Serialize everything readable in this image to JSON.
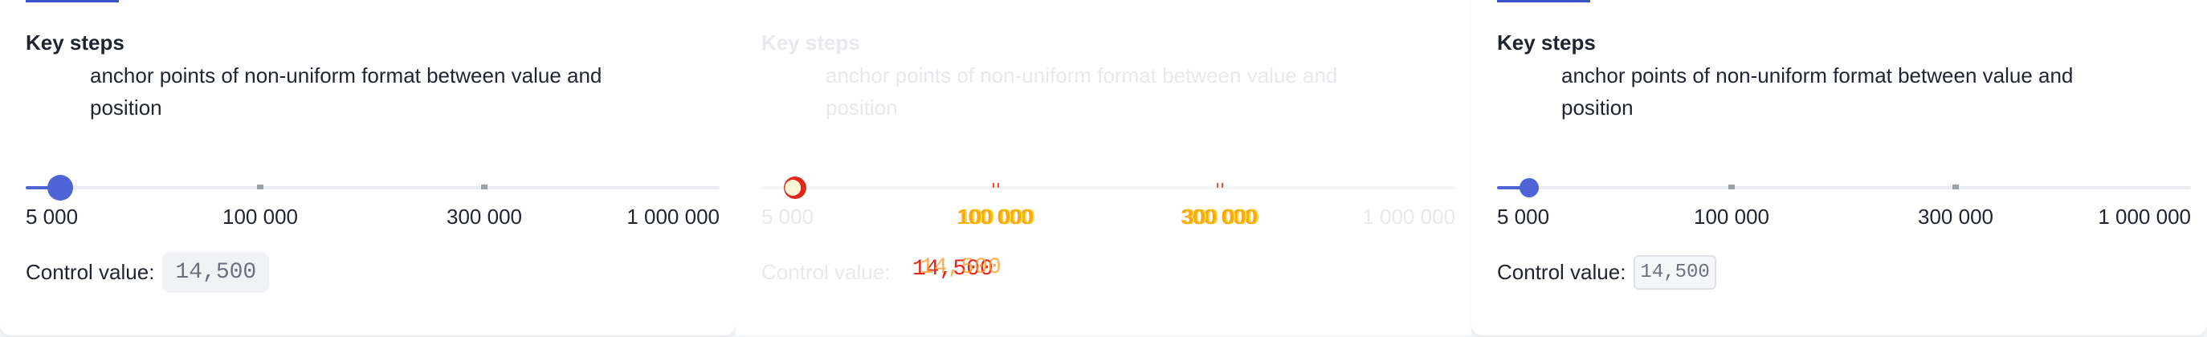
{
  "panels": [
    {
      "heading": "Key steps",
      "description": "anchor points of non-uniform format between value and position",
      "slider_value_fraction": 0.05,
      "tick_labels": [
        "5 000",
        "100 000",
        "300 000",
        "1 000 000"
      ],
      "control_label": "Control value:",
      "control_value": "14,500"
    },
    {
      "heading": "Key steps",
      "description": "anchor points of non-uniform format between value and position",
      "tick_labels": [
        "5 000",
        "100 000",
        "300 000",
        "1 000 000"
      ],
      "control_label": "Control value:",
      "control_value": "14,500"
    },
    {
      "heading": "Key steps",
      "description": "anchor points of non-uniform format between value and position",
      "slider_value_fraction": 0.045,
      "tick_labels": [
        "5 000",
        "100 000",
        "300 000",
        "1 000 000"
      ],
      "control_label": "Control value:",
      "control_value": "14,500"
    }
  ],
  "colors": {
    "accent": "#4d63d6",
    "tab_accent": "#3a55c9",
    "text": "#1f2430",
    "muted_text": "#6b7080",
    "ghost_text": "#e8e9ec",
    "glitch_red": "#e3261a",
    "glitch_yellow": "#f0b400"
  }
}
